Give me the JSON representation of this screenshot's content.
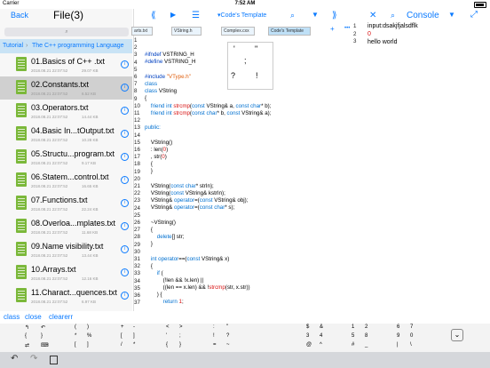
{
  "status": {
    "carrier": "Carrier",
    "time": "7:52 AM"
  },
  "left": {
    "back": "Back",
    "title": "File(3)",
    "search_placeholder": "⌕",
    "breadcrumb_root": "Tutorial",
    "breadcrumb_folder": "The C++ programming Language",
    "files": [
      {
        "name": "01.Basics of C++ .txt",
        "date": "2018.08.21 22:07:52",
        "size": "29.07 KB"
      },
      {
        "name": "02.Constants.txt",
        "date": "2018.08.21 22:07:52",
        "size": "6.52 KB"
      },
      {
        "name": "03.Operators.txt",
        "date": "2018.08.21 22:07:52",
        "size": "14.44 KB"
      },
      {
        "name": "04.Basic In...tOutput.txt",
        "date": "2018.08.21 22:07:52",
        "size": "10.28 KB"
      },
      {
        "name": "05.Structu...program.txt",
        "date": "2018.08.21 22:07:52",
        "size": "9.17 KB"
      },
      {
        "name": "06.Statem...control.txt",
        "date": "2018.08.21 22:07:52",
        "size": "16.65 KB"
      },
      {
        "name": "07.Functions.txt",
        "date": "2018.08.21 22:07:52",
        "size": "22.24 KB"
      },
      {
        "name": "08.Overloa...mplates.txt",
        "date": "2018.08.21 22:07:52",
        "size": "11.68 KB"
      },
      {
        "name": "09.Name visibility.txt",
        "date": "2018.08.21 22:07:52",
        "size": "13.44 KB"
      },
      {
        "name": "10.Arrays.txt",
        "date": "2018.08.21 22:07:52",
        "size": "12.16 KB"
      },
      {
        "name": "11.Charact...quences.txt",
        "date": "2018.08.21 22:07:52",
        "size": "6.97 KB"
      }
    ]
  },
  "editor": {
    "title": "Code's Template",
    "tabs": [
      "arts.txt",
      "VString.h",
      "Complex.cxx",
      "Code's Template"
    ],
    "popup_chars": [
      "'",
      "\"",
      ";",
      "?",
      "!"
    ]
  },
  "console": {
    "title": "Console",
    "lines": [
      "input:dsakjfjalsdflk",
      "0",
      "hello world"
    ]
  },
  "commands": [
    "class",
    "close",
    "clearerr"
  ],
  "keys": [
    [
      "↰",
      "↶",
      "(",
      ")",
      "+",
      "-",
      "<",
      ">",
      ":",
      "\"",
      "$",
      "&",
      "1",
      "2",
      "6",
      "7"
    ],
    [
      "{",
      "}",
      "*",
      "%",
      "[",
      "]",
      "'",
      ";",
      "!",
      "?",
      "3",
      "4",
      "5",
      "8",
      "9",
      "0"
    ],
    [
      "⇄",
      "⌨",
      "[",
      "]",
      "/",
      "*",
      "{",
      "}",
      "=",
      "~",
      "@",
      "^",
      "#",
      "_",
      "|",
      "\\"
    ]
  ]
}
